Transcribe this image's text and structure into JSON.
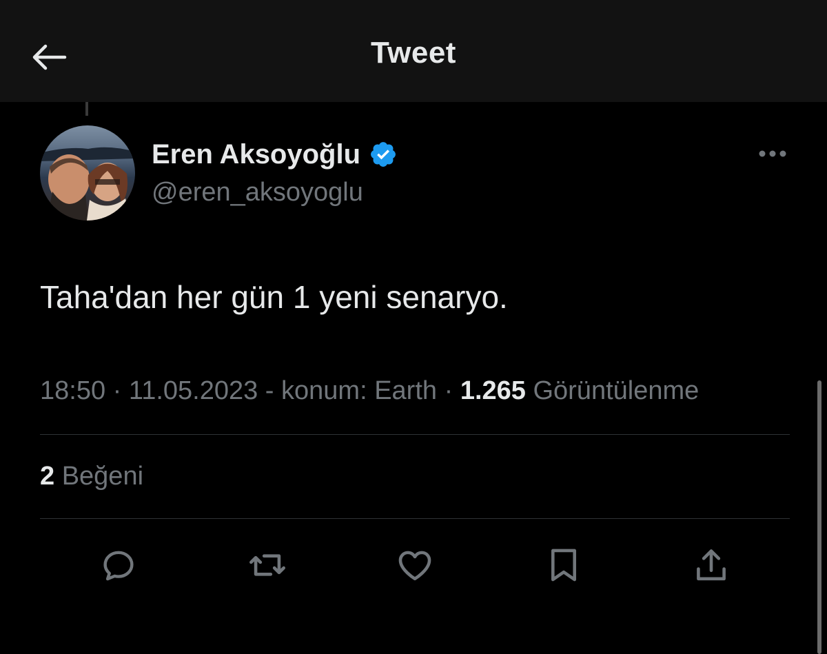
{
  "header": {
    "title": "Tweet",
    "back_icon": "arrow-left-icon"
  },
  "tweet": {
    "author": {
      "display_name": "Eren Aksoyoğlu",
      "handle": "@eren_aksoyoglu",
      "verified": true,
      "verified_color": "#1d9bf0"
    },
    "text": "Taha'dan her gün 1 yeni senaryo.",
    "meta": {
      "time": "18:50",
      "separator1": " · ",
      "date": "11.05.2023",
      "location_prefix": " - konum: ",
      "location": "Earth",
      "separator2": " · ",
      "views_count": "1.265",
      "views_label": " Görüntülenme"
    },
    "likes": {
      "count": "2",
      "label": " Beğeni"
    }
  },
  "actions": [
    {
      "name": "reply",
      "icon": "reply-icon"
    },
    {
      "name": "retweet",
      "icon": "retweet-icon"
    },
    {
      "name": "like",
      "icon": "heart-icon"
    },
    {
      "name": "bookmark",
      "icon": "bookmark-icon"
    },
    {
      "name": "share",
      "icon": "share-icon"
    }
  ],
  "colors": {
    "background": "#000000",
    "header_background": "#121212",
    "primary_text": "#e7e9ea",
    "secondary_text": "#71767b",
    "divider": "#2f3336",
    "accent": "#1d9bf0"
  }
}
